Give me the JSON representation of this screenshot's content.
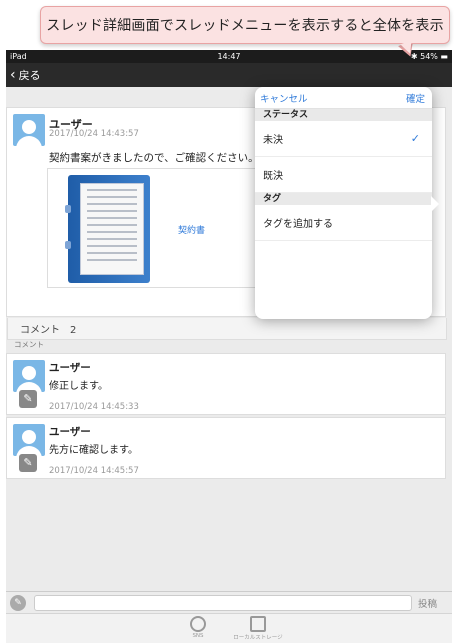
{
  "callout": {
    "text": "スレッド詳細画面でスレッドメニューを表示すると全体を表示"
  },
  "statusbar": {
    "device": "iPad",
    "time": "14:47",
    "battery": "54%"
  },
  "navbar": {
    "back_label": "戻る"
  },
  "post": {
    "author": "ユーザー",
    "timestamp": "2017/10/24 14:43:57",
    "body": "契約書案がきましたので、ご確認ください。",
    "attachment_label": "契約書",
    "comment_count_text": "コメント　2"
  },
  "comments_section_label": "コメント",
  "comments": [
    {
      "author": "ユーザー",
      "text": "修正します。",
      "timestamp": "2017/10/24 14:45:33"
    },
    {
      "author": "ユーザー",
      "text": "先方に確認します。",
      "timestamp": "2017/10/24 14:45:57"
    }
  ],
  "inputbar": {
    "post_label": "投稿"
  },
  "tabbar": {
    "tabs": [
      {
        "label": "SNS"
      },
      {
        "label": "ローカルストレージ"
      }
    ]
  },
  "popover": {
    "cancel_label": "キャンセル",
    "confirm_label": "確定",
    "status_section": "ステータス",
    "status_options": [
      {
        "label": "未決",
        "selected": true
      },
      {
        "label": "既決",
        "selected": false
      }
    ],
    "tag_section": "タグ",
    "add_tag_label": "タグを追加する"
  },
  "colors": {
    "accent": "#2f7ad9",
    "avatar": "#7ab7e6",
    "callout_bg": "#fbe2e2"
  }
}
